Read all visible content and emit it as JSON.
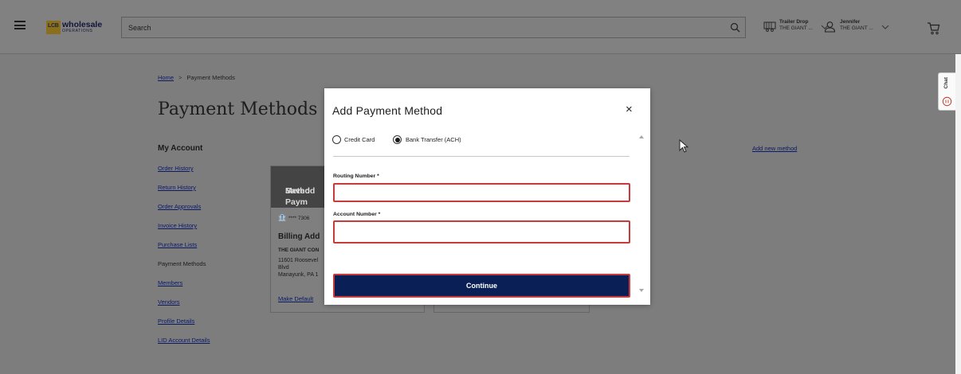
{
  "header": {
    "logo": {
      "badge": "LCB",
      "name": "wholesale",
      "sub": "OPERATIONS"
    },
    "search_placeholder": "Search",
    "delivery": {
      "title": "Trailer Drop",
      "sub": "THE GIANT ..."
    },
    "user": {
      "title": "Jennifer",
      "sub": "THE GIANT ..."
    }
  },
  "breadcrumb": {
    "home": "Home",
    "separator": ">",
    "current": "Payment Methods"
  },
  "page_title": "Payment Methods",
  "sidebar": {
    "heading": "My Account",
    "items": [
      {
        "label": "Order History",
        "active": false
      },
      {
        "label": "Return History",
        "active": false
      },
      {
        "label": "Order Approvals",
        "active": false
      },
      {
        "label": "Invoice History",
        "active": false
      },
      {
        "label": "Purchase Lists",
        "active": false
      },
      {
        "label": "Payment Methods",
        "active": true
      },
      {
        "label": "Members",
        "active": false
      },
      {
        "label": "Vendors",
        "active": false
      },
      {
        "label": "Profile Details",
        "active": false
      },
      {
        "label": "LID Account Details",
        "active": false
      }
    ]
  },
  "add_new_method": "Add new method",
  "saved_card": {
    "header_line1": "Saved Paym",
    "header_line2": "Method",
    "bank_masked": "**** 7306",
    "billing_title": "Billing Add",
    "company": "THE GIANT CON",
    "address_line1": "11601 Roosevel",
    "address_line2": "Blvd",
    "address_line3": "Manayunk, PA 1",
    "make_default": "Make Default"
  },
  "chat_label": "Chat",
  "modal": {
    "title": "Add Payment Method",
    "close": "×",
    "options": [
      {
        "label": "Credit Card",
        "checked": false
      },
      {
        "label": "Bank Transfer (ACH)",
        "checked": true
      }
    ],
    "routing_label": "Routing Number *",
    "routing_value": "",
    "account_label": "Account Number *",
    "account_value": "",
    "continue": "Continue"
  },
  "colors": {
    "overlay": "#7d7d7d",
    "button_navy": "#0a1f55",
    "error_red": "#c93b3b",
    "link_blue": "#0b1a66"
  }
}
